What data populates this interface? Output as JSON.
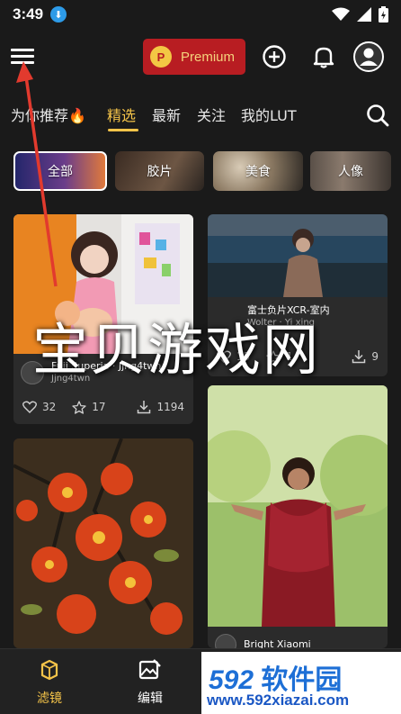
{
  "status_bar": {
    "time": "3:49"
  },
  "header": {
    "premium_label": "Premium",
    "premium_logo": "P"
  },
  "tabs": [
    {
      "label": "为你推荐🔥"
    },
    {
      "label": "精选"
    },
    {
      "label": "最新"
    },
    {
      "label": "关注"
    },
    {
      "label": "我的LUT"
    }
  ],
  "categories": [
    {
      "label": "全部",
      "selected": true
    },
    {
      "label": "胶片"
    },
    {
      "label": "美食"
    },
    {
      "label": "人像"
    }
  ],
  "cards": [
    {
      "author": "Fuji Superia · Jjng4twn",
      "subtitle": "Jjng4twn",
      "likes": "32",
      "stars": "17",
      "downloads": "1194"
    },
    {
      "author": "富士负片XCR-室内",
      "subtitle": "Wolter · Yi xing",
      "likes": "15",
      "stars": "1",
      "downloads": "9"
    },
    {
      "author": ""
    },
    {
      "author": "Bright Xiaomi"
    }
  ],
  "bottom_nav": [
    {
      "label": "滤镜",
      "active": true
    },
    {
      "label": "编辑"
    }
  ],
  "watermark": {
    "text": "宝贝游戏网",
    "site_num": "592",
    "site_cn": "软件园",
    "site_url": "www.592xiazai.com"
  },
  "colors": {
    "accent": "#f5c449",
    "premium_bg": "#b81d22",
    "background": "#1a1a1a"
  }
}
